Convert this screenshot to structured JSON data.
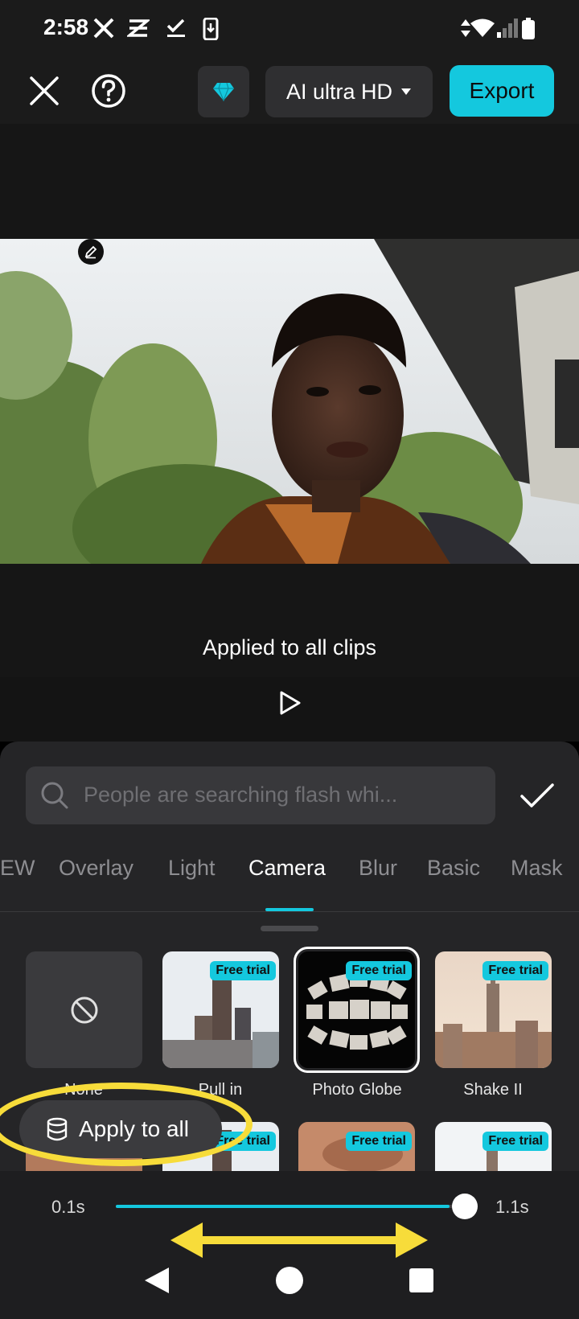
{
  "status_bar": {
    "time": "2:58",
    "icons_left": [
      "x-logo-icon",
      "capcut-icon",
      "check-download-icon",
      "phone-download-icon"
    ],
    "icons_right": [
      "data-arrows-icon",
      "wifi-icon",
      "signal-icon",
      "battery-icon"
    ]
  },
  "toolbar": {
    "close_icon": "close-icon",
    "help_icon": "help-icon",
    "pro_icon": "diamond-icon",
    "quality_label": "AI ultra HD",
    "export_label": "Export",
    "accent_color": "#14c8de"
  },
  "preview": {
    "toast": "Applied to all clips",
    "play_icon": "play-icon"
  },
  "panel": {
    "search_placeholder": "People are searching flash whi...",
    "tabs": [
      {
        "label": "EW",
        "active": false
      },
      {
        "label": "Overlay",
        "active": false
      },
      {
        "label": "Light",
        "active": false
      },
      {
        "label": "Camera",
        "active": true
      },
      {
        "label": "Blur",
        "active": false
      },
      {
        "label": "Basic",
        "active": false
      },
      {
        "label": "Mask",
        "active": false
      }
    ],
    "effects_row1": [
      {
        "label": "None",
        "badge": ""
      },
      {
        "label": "Pull in",
        "badge": "Free trial"
      },
      {
        "label": "Photo Globe",
        "badge": "Free trial",
        "selected": true
      },
      {
        "label": "Shake II",
        "badge": "Free trial"
      }
    ],
    "effects_row2": [
      {
        "badge": ""
      },
      {
        "badge": "Free trial"
      },
      {
        "badge": "Free trial"
      },
      {
        "badge": "Free trial"
      }
    ],
    "apply_all_label": "Apply to all"
  },
  "duration": {
    "min": "0.1s",
    "max": "1.1s",
    "value_fraction": 0.94
  },
  "annotation_color": "#f7dc3a"
}
